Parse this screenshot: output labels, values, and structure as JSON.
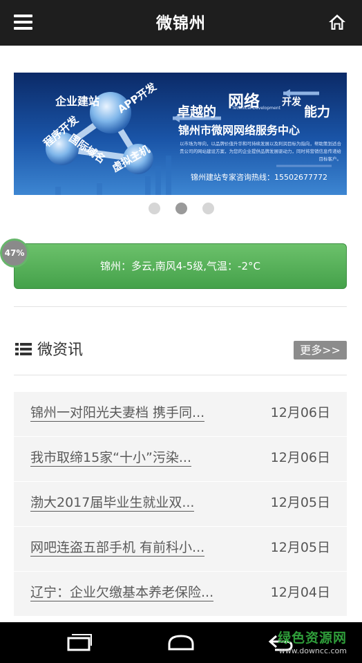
{
  "header": {
    "title": "微锦州"
  },
  "banner": {
    "words": {
      "corp_site": "企业建站",
      "app_dev": "APP开发",
      "intl_domain": "国际域名",
      "program_dev": "程序开发",
      "virtual_host": "虚拟主机"
    },
    "slogan_left": "卓越的",
    "slogan_net": "网络",
    "slogan_net_suffix": "开发",
    "slogan_right": "能力",
    "tech_dev": "Technical Development",
    "center_name": "锦州市微网网络服务中心",
    "description": "以市场为导向，以品牌价值升华和可持续发展以及利润目标为指向，帮助策划适合贵公司的网站建设方案，为您的企业提供品牌发展驱动力，同时将营销信息传递给目标客户。",
    "hotline": "锦州建站专家咨询热线：15502677772",
    "slides": 3,
    "active_slide": 2
  },
  "weather": {
    "text": "锦州：多云,南风4-5级,气温：-2°C",
    "progress": "47%"
  },
  "news": {
    "title": "微资讯",
    "more_label": "更多>>",
    "items": [
      {
        "headline": "锦州一对阳光夫妻档 携手同...",
        "date": "12月06日"
      },
      {
        "headline": "我市取缔15家“十小”污染...",
        "date": "12月06日"
      },
      {
        "headline": "渤大2017届毕业生就业双...",
        "date": "12月05日"
      },
      {
        "headline": "网吧连盗五部手机 有前科小...",
        "date": "12月05日"
      },
      {
        "headline": "辽宁：企业欠缴基本养老保险...",
        "date": "12月04日"
      }
    ]
  },
  "watermark": {
    "main": "绿色资源网",
    "url": "www.downcc.com"
  },
  "colors": {
    "topbar": "#1e1e1e",
    "weather_green": "#44a14a",
    "more_button": "#8c8c8c",
    "watermark_green": "#2f9e3a"
  },
  "icons": {
    "menu": "menu-icon",
    "home": "home-icon",
    "list": "list-icon",
    "back": "back-icon",
    "home_nav": "home-nav-icon",
    "recents": "recents-icon"
  }
}
